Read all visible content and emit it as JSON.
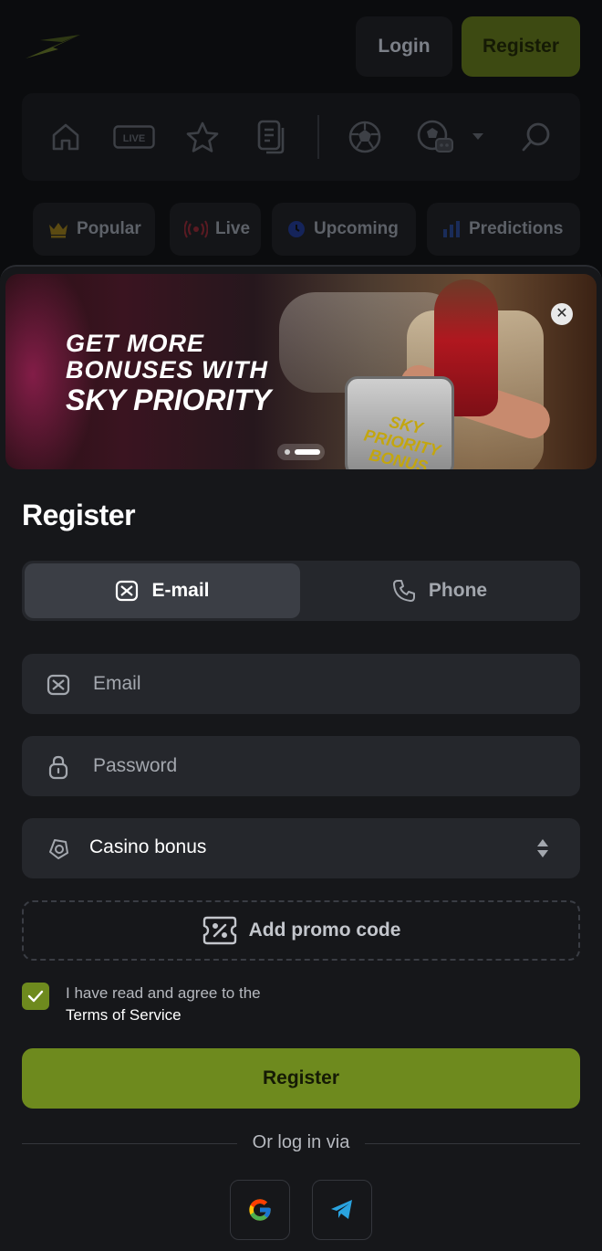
{
  "header": {
    "login_label": "Login",
    "register_label": "Register"
  },
  "nav": {
    "live_badge": "LIVE",
    "icons": [
      "home-icon",
      "live-icon",
      "star-icon",
      "betslip-icon",
      "soccer-ball-icon",
      "esports-ball-icon",
      "chevron-down-icon",
      "search-icon"
    ]
  },
  "chips": [
    {
      "label": "Popular",
      "icon": "crown-icon"
    },
    {
      "label": "Live",
      "icon": "broadcast-icon"
    },
    {
      "label": "Upcoming",
      "icon": "clock-icon"
    },
    {
      "label": "Predictions",
      "icon": "bar-chart-icon"
    }
  ],
  "banner": {
    "line1": "GET MORE",
    "line2": "BONUSES WITH",
    "line3": "SKY PRIORITY",
    "case_label": "SKY PRIORITY BONUS",
    "close_glyph": "✕"
  },
  "register": {
    "title": "Register",
    "tab_email": "E-mail",
    "tab_phone": "Phone",
    "email_placeholder": "Email",
    "password_placeholder": "Password",
    "bonus_value": "Casino bonus",
    "promo_label": "Add promo code",
    "agree_text": "I have read and agree to the",
    "terms_link": "Terms of Service",
    "submit_label": "Register",
    "or_login": "Or log in via"
  },
  "colors": {
    "accent": "#6e8a1e",
    "background": "#0b0c0e",
    "modal": "#16171a",
    "field": "#25272c"
  }
}
